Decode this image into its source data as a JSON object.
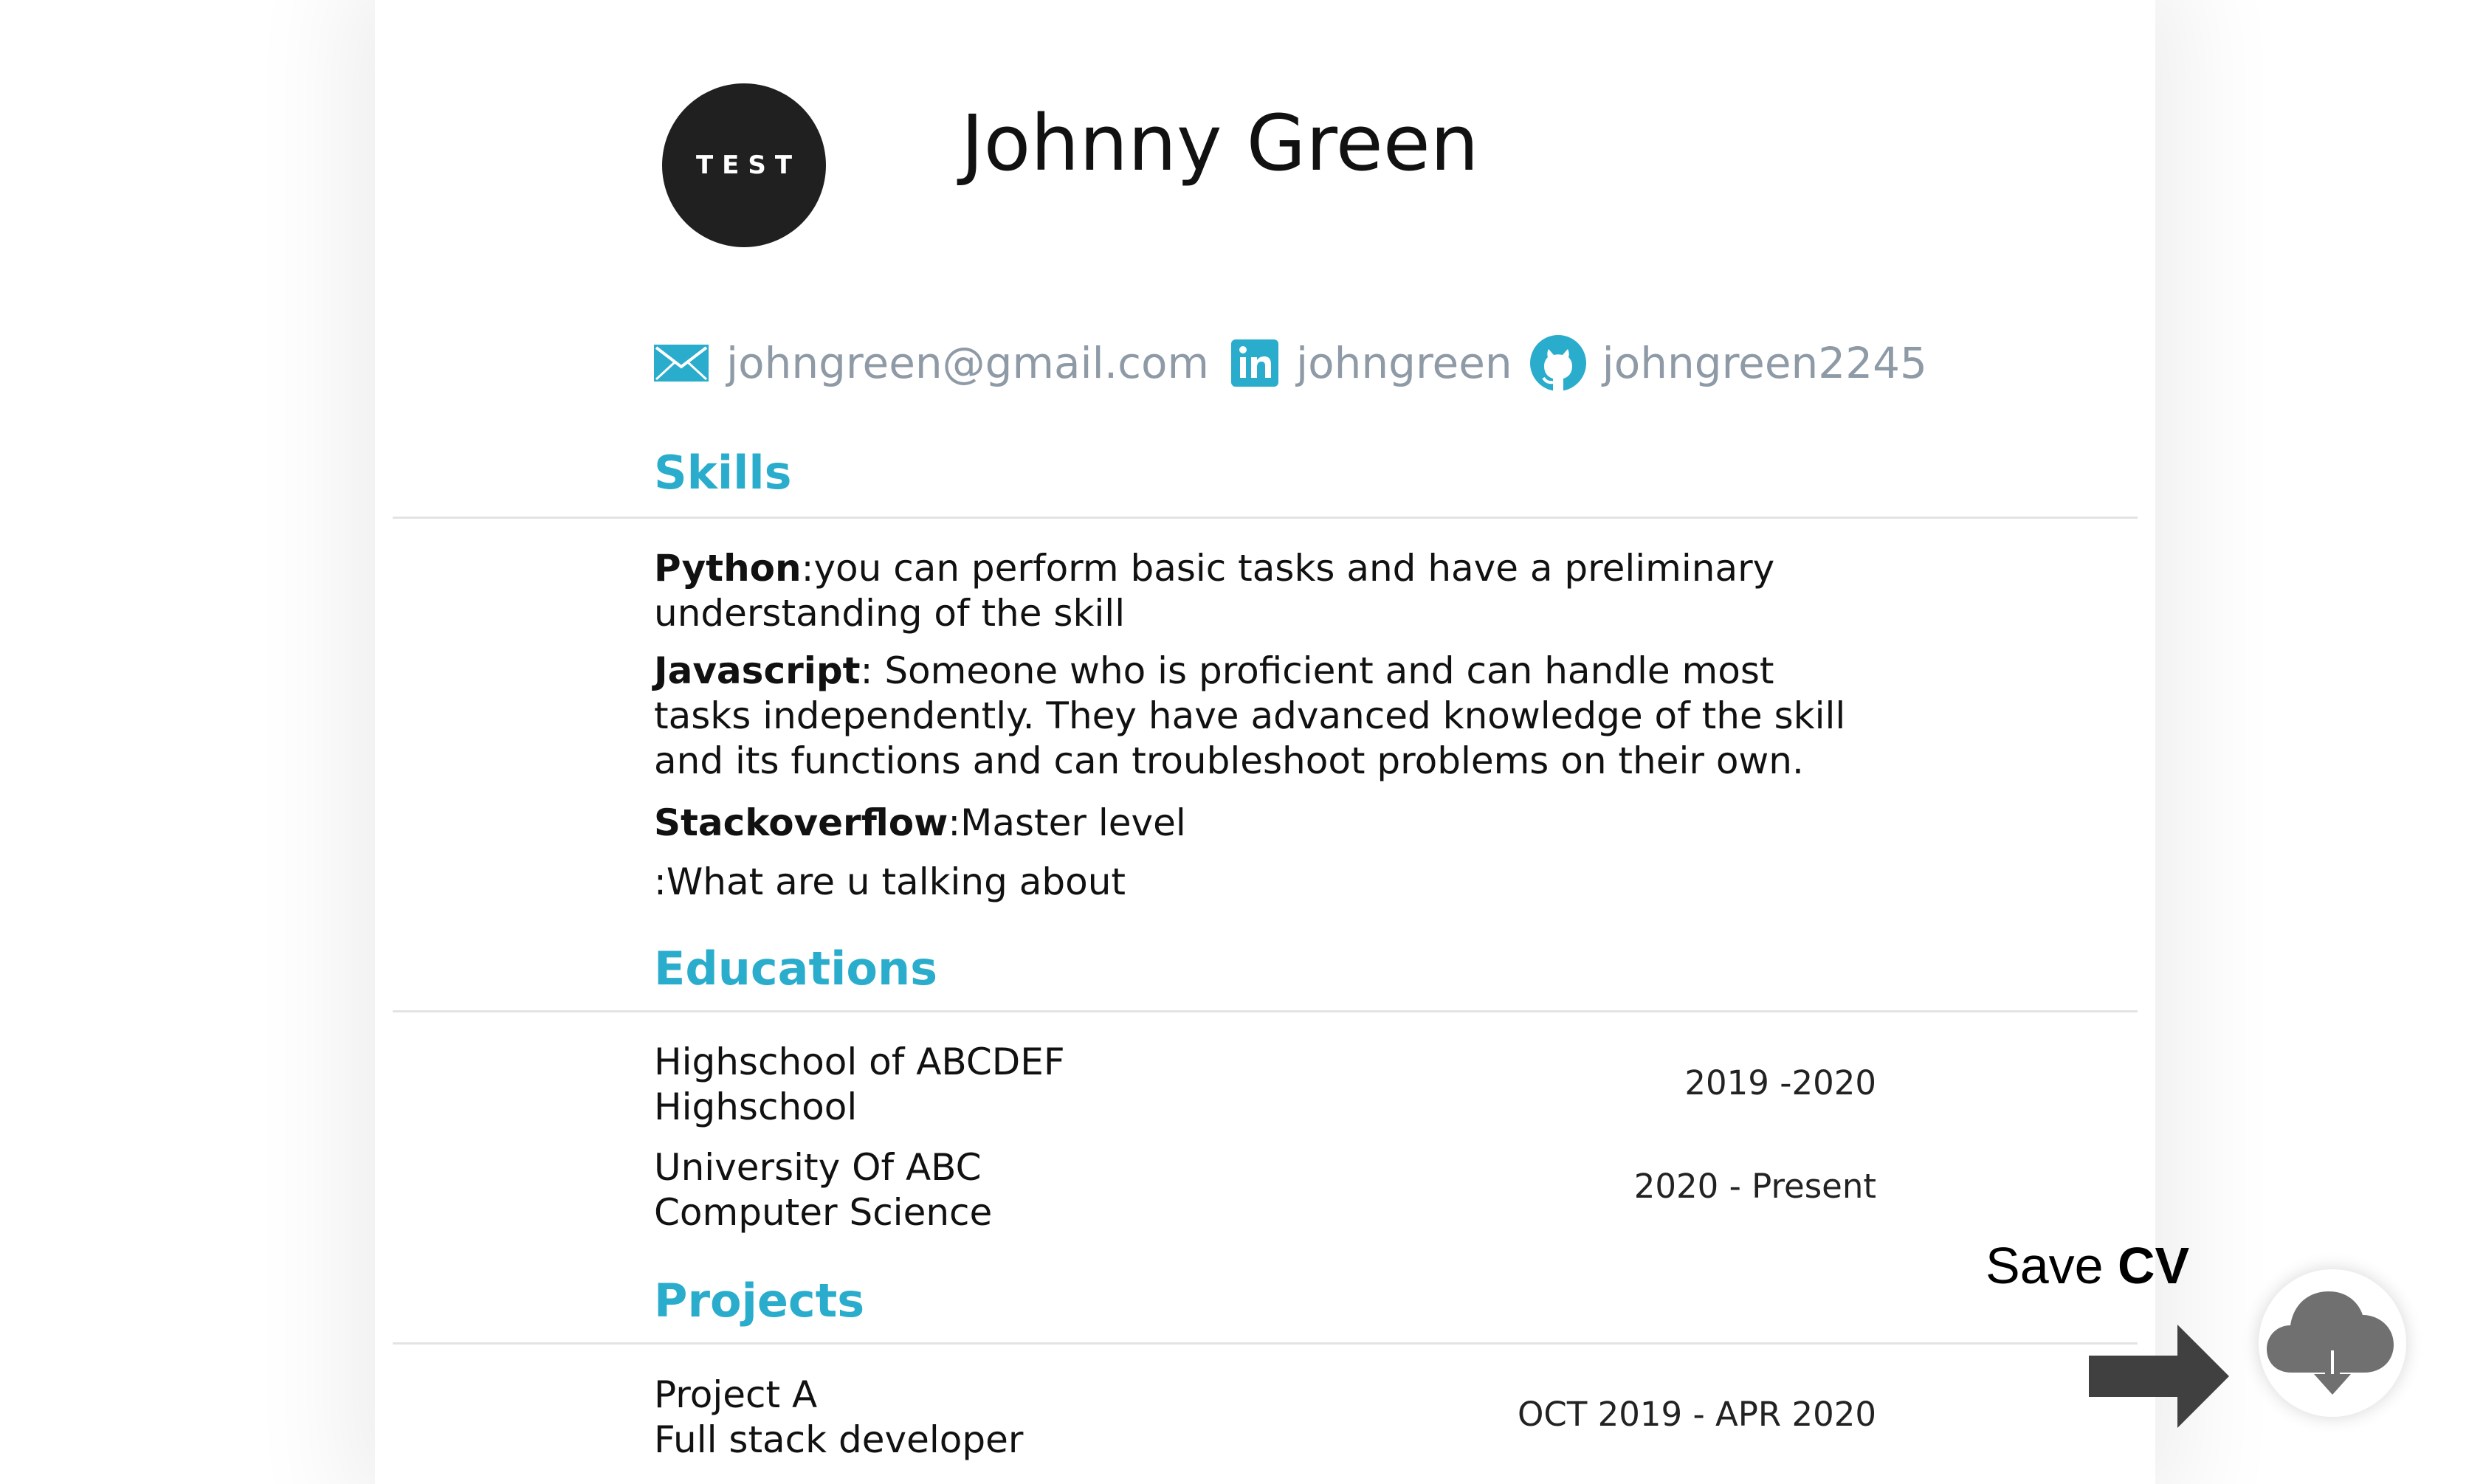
{
  "profile": {
    "avatar_text": "TEST",
    "name": "Johnny Green"
  },
  "contacts": {
    "email": "johngreen@gmail.com",
    "linkedin": "johngreen",
    "github": "johngreen2245",
    "icons": [
      "mail-icon",
      "linkedin-icon",
      "github-icon"
    ]
  },
  "skills": {
    "title": "Skills",
    "python_name": "Python",
    "python_desc_1": ":you can perform basic tasks and have a preliminary",
    "python_desc_2": "understanding of the skill",
    "javascript_name": "Javascript",
    "javascript_desc_1": ": Someone who is proficient and can handle most",
    "javascript_desc_2": "tasks independently. They have advanced knowledge of the skill",
    "javascript_desc_3": "and its functions and can troubleshoot problems on their own.",
    "stackoverflow_name": "Stackoverflow",
    "stackoverflow_desc": ":Master level",
    "unnamed_desc": ":What are u talking about"
  },
  "educations": {
    "title": "Educations",
    "items": [
      {
        "school": "Highschool of ABCDEF",
        "degree": "Highschool",
        "dates": "2019 -2020"
      },
      {
        "school": "University Of ABC",
        "degree": "Computer Science",
        "dates": "2020 - Present"
      }
    ]
  },
  "projects": {
    "title": "Projects",
    "items": [
      {
        "name": "Project A",
        "role": "Full stack developer",
        "dates": "OCT 2019 - APR 2020"
      }
    ]
  },
  "save": {
    "label_prefix": "Save ",
    "label_bold": "CV",
    "icon": "cloud-download-icon"
  },
  "colors": {
    "accent": "#2aaccc",
    "contact_text": "#8e9aa6",
    "avatar_bg": "#202020"
  }
}
